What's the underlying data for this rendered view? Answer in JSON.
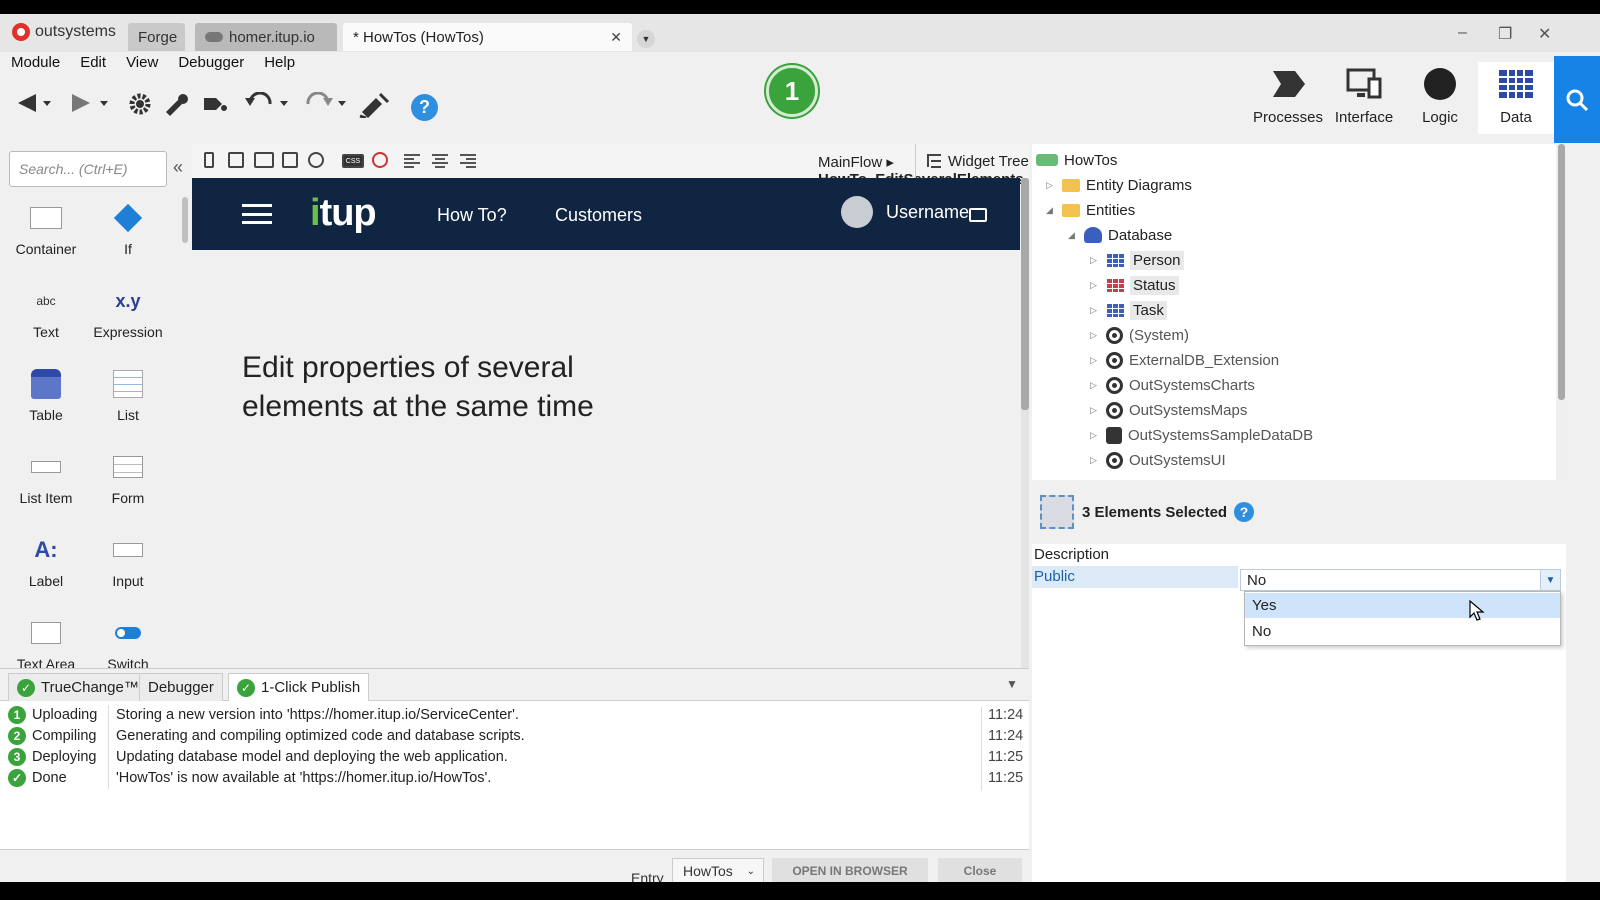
{
  "titlebar": {
    "brand": "outsystems",
    "tabs": [
      {
        "label": "Forge"
      },
      {
        "label": "homer.itup.io"
      },
      {
        "label": "* HowTos (HowTos)"
      }
    ],
    "close_glyph": "✕",
    "dropdown_glyph": "▼",
    "window_controls": [
      "–",
      "❐",
      "✕"
    ]
  },
  "menu": [
    "Module",
    "Edit",
    "View",
    "Debugger",
    "Help"
  ],
  "toolbar": {
    "icons": [
      "back-icon",
      "forward-icon",
      "settings-icon",
      "refactor-icon",
      "merge-icon",
      "undo-icon",
      "redo-icon",
      "publish-icon",
      "help-icon"
    ],
    "help_label": "?"
  },
  "status_badge": "1",
  "top_tabs": [
    {
      "label": "Processes",
      "icon": "processes-icon"
    },
    {
      "label": "Interface",
      "icon": "interface-icon"
    },
    {
      "label": "Logic",
      "icon": "logic-icon"
    },
    {
      "label": "Data",
      "icon": "data-icon"
    }
  ],
  "left_panel": {
    "search_placeholder": "Search... (Ctrl+E)",
    "collapse_glyph": "«",
    "widgets": [
      {
        "label": "Container"
      },
      {
        "label": "If"
      },
      {
        "label": "Text"
      },
      {
        "label": "Expression"
      },
      {
        "label": "Table"
      },
      {
        "label": "List"
      },
      {
        "label": "List Item"
      },
      {
        "label": "Form"
      },
      {
        "label": "Label"
      },
      {
        "label": "Input"
      },
      {
        "label": "Text Area"
      },
      {
        "label": "Switch"
      }
    ],
    "text_icon_label": "abc",
    "expression_icon_label": "x.y",
    "label_icon_label": "A:"
  },
  "canvas_toolbar": {
    "breadcrumb_parent": "MainFlow",
    "breadcrumb_sep": "▸",
    "breadcrumb_current": "HowTo_EditSeveralElements",
    "widget_tree_label": "Widget Tree",
    "css_label": "CSS"
  },
  "app_preview": {
    "brand": "itup",
    "nav": [
      "How To?",
      "Customers"
    ],
    "username": "Username",
    "heading": "Edit properties of several elements at the same time"
  },
  "bottom_panel": {
    "tabs": [
      {
        "label": "TrueChange™"
      },
      {
        "label": "Debugger"
      },
      {
        "label": "1-Click Publish"
      }
    ],
    "log": [
      {
        "step": "1",
        "status": "Uploading",
        "message": "Storing a new version into 'https://homer.itup.io/ServiceCenter'.",
        "time": "11:24"
      },
      {
        "step": "2",
        "status": "Compiling",
        "message": "Generating and compiling optimized code and database scripts.",
        "time": "11:24"
      },
      {
        "step": "3",
        "status": "Deploying",
        "message": "Updating database model and deploying the web application.",
        "time": "11:25"
      },
      {
        "step": "✓",
        "status": "Done",
        "message": "'HowTos' is now available at 'https://homer.itup.io/HowTos'.",
        "time": "11:25"
      }
    ],
    "entry_label": "Entry",
    "entry_value": "HowTos",
    "open_browser": "OPEN IN BROWSER",
    "close": "Close"
  },
  "tree": {
    "root": "HowTos",
    "entity_diagrams": "Entity Diagrams",
    "entities": "Entities",
    "database": "Database",
    "items": [
      "Person",
      "Status",
      "Task"
    ],
    "modules": [
      "(System)",
      "ExternalDB_Extension",
      "OutSystemsCharts",
      "OutSystemsMaps",
      "OutSystemsSampleDataDB",
      "OutSystemsUI"
    ]
  },
  "properties": {
    "title": "3 Elements Selected",
    "help_label": "?",
    "rows": [
      {
        "key": "Description",
        "value": ""
      },
      {
        "key": "Public",
        "value": "No"
      }
    ],
    "dropdown_options": [
      "Yes",
      "No"
    ]
  },
  "colors": {
    "accent": "#1684e6",
    "publish_green": "#3aa33c",
    "app_header": "#0f2542"
  }
}
